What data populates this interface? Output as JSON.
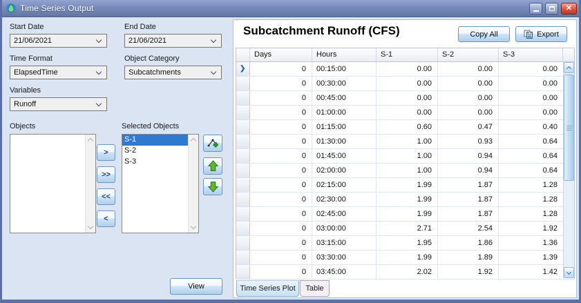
{
  "window": {
    "title": "Time Series Output"
  },
  "icons": {
    "app": "water-drop-icon",
    "close": "✕",
    "row_marker": "❯"
  },
  "colors": {
    "titlebar": "#7b8dbe",
    "panel_bg": "#dae4f3",
    "selection_blue": "#2e7ad1",
    "arrow_green": "#52b43c",
    "close_red": "#d9503a"
  },
  "left_panel": {
    "fields": [
      {
        "label": "Start Date",
        "value": "21/06/2021"
      },
      {
        "label": "End Date",
        "value": "21/06/2021"
      },
      {
        "label": "Time Format",
        "value": "ElapsedTime"
      },
      {
        "label": "Object Category",
        "value": "Subcatchments"
      },
      {
        "label": "Variables",
        "value": "Runoff"
      }
    ],
    "objects_label": "Objects",
    "selected_objects_label": "Selected Objects",
    "selected_objects": [
      "S-1",
      "S-2",
      "S-3"
    ],
    "selected_index": 0,
    "transfer_buttons": [
      ">",
      ">>",
      "<<",
      "<"
    ],
    "view_button": "View"
  },
  "main": {
    "title": "Subcatchment Runoff (CFS)",
    "copy_all_button": "Copy All",
    "export_button": "Export",
    "table": {
      "columns": [
        "Days",
        "Hours",
        "S-1",
        "S-2",
        "S-3"
      ],
      "rows": [
        [
          "0",
          "00:15:00",
          "0.00",
          "0.00",
          "0.00"
        ],
        [
          "0",
          "00:30:00",
          "0.00",
          "0.00",
          "0.00"
        ],
        [
          "0",
          "00:45:00",
          "0.00",
          "0.00",
          "0.00"
        ],
        [
          "0",
          "01:00:00",
          "0.00",
          "0.00",
          "0.00"
        ],
        [
          "0",
          "01:15:00",
          "0.60",
          "0.47",
          "0.40"
        ],
        [
          "0",
          "01:30:00",
          "1.00",
          "0.93",
          "0.64"
        ],
        [
          "0",
          "01:45:00",
          "1.00",
          "0.94",
          "0.64"
        ],
        [
          "0",
          "02:00:00",
          "1.00",
          "0.94",
          "0.64"
        ],
        [
          "0",
          "02:15:00",
          "1.99",
          "1.87",
          "1.28"
        ],
        [
          "0",
          "02:30:00",
          "1.99",
          "1.87",
          "1.28"
        ],
        [
          "0",
          "02:45:00",
          "1.99",
          "1.87",
          "1.28"
        ],
        [
          "0",
          "03:00:00",
          "2.71",
          "2.54",
          "1.92"
        ],
        [
          "0",
          "03:15:00",
          "1.95",
          "1.86",
          "1.36"
        ],
        [
          "0",
          "03:30:00",
          "1.99",
          "1.89",
          "1.39"
        ],
        [
          "0",
          "03:45:00",
          "2.02",
          "1.92",
          "1.42"
        ]
      ]
    },
    "tabs": [
      {
        "label": "Time Series Plot",
        "active": false
      },
      {
        "label": "Table",
        "active": true
      }
    ]
  }
}
